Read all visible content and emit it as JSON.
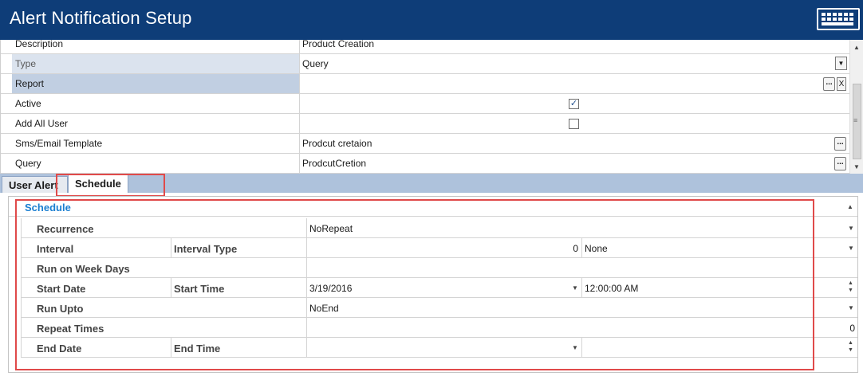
{
  "window": {
    "title": "Alert Notification Setup",
    "keyboard_icon": "keyboard-icon"
  },
  "properties": [
    {
      "label": "Description",
      "value": "Product Creation",
      "control": "text"
    },
    {
      "label": "Type",
      "value": "Query",
      "control": "dropdown"
    },
    {
      "label": "Report",
      "value": "",
      "control": "ellipsis-clear"
    },
    {
      "label": "Active",
      "value": "checked",
      "control": "checkbox"
    },
    {
      "label": "Add All User",
      "value": "unchecked",
      "control": "checkbox"
    },
    {
      "label": "Sms/Email Template",
      "value": "Prodcut cretaion",
      "control": "ellipsis"
    },
    {
      "label": "Query",
      "value": "ProdcutCretion",
      "control": "ellipsis"
    }
  ],
  "buttons": {
    "ellipsis": "...",
    "clear": "X",
    "checkmark": "✓"
  },
  "tabs": [
    {
      "label": "User Alert",
      "active": false
    },
    {
      "label": "Schedule",
      "active": true
    }
  ],
  "schedule": {
    "header": "Schedule",
    "rows": [
      {
        "label": "Recurrence",
        "label2": "",
        "value": "NoRepeat",
        "value2": ""
      },
      {
        "label": "Interval",
        "label2": "Interval Type",
        "value": "0",
        "value2": "None"
      },
      {
        "label": "Run on Week Days",
        "label2": "",
        "value": "",
        "value2": ""
      },
      {
        "label": "Start Date",
        "label2": "Start Time",
        "value": "3/19/2016",
        "value2": "12:00:00 AM"
      },
      {
        "label": "Run Upto",
        "label2": "",
        "value": "NoEnd",
        "value2": ""
      },
      {
        "label": "Repeat Times",
        "label2": "",
        "value": "0",
        "value2": ""
      },
      {
        "label": "End Date",
        "label2": "End Time",
        "value": "",
        "value2": ""
      }
    ]
  },
  "colors": {
    "titlebar": "#0e3d78",
    "tabstrip": "#aec2dc",
    "highlight": "#e04a4a",
    "schedule_header": "#1b7fd1"
  }
}
